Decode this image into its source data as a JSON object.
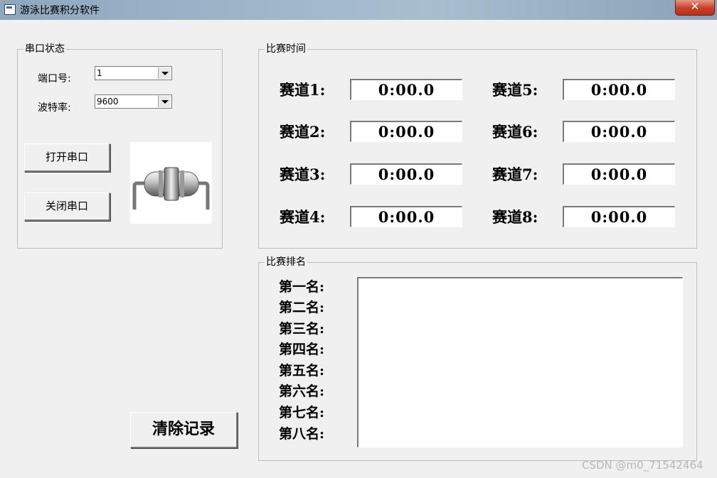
{
  "window": {
    "title": "游泳比赛积分软件",
    "close_label": "✕"
  },
  "serial": {
    "group_label": "串口状态",
    "port_label": "端口号:",
    "port_value": "1",
    "baud_label": "波特率:",
    "baud_value": "9600",
    "open_button": "打开串口",
    "close_button": "关闭串口"
  },
  "timing": {
    "group_label": "比赛时间",
    "lanes": [
      {
        "label": "赛道1:",
        "time": "0:00.0"
      },
      {
        "label": "赛道2:",
        "time": "0:00.0"
      },
      {
        "label": "赛道3:",
        "time": "0:00.0"
      },
      {
        "label": "赛道4:",
        "time": "0:00.0"
      },
      {
        "label": "赛道5:",
        "time": "0:00.0"
      },
      {
        "label": "赛道6:",
        "time": "0:00.0"
      },
      {
        "label": "赛道7:",
        "time": "0:00.0"
      },
      {
        "label": "赛道8:",
        "time": "0:00.0"
      }
    ]
  },
  "ranking": {
    "group_label": "比赛排名",
    "places": [
      "第一名:",
      "第二名:",
      "第三名:",
      "第四名:",
      "第五名:",
      "第六名:",
      "第七名:",
      "第八名:"
    ]
  },
  "actions": {
    "clear_button": "清除记录"
  },
  "watermark": "CSDN @m0_71542464",
  "icons": {
    "app": "app-window-icon",
    "serial_picture": "serial-connector-icon",
    "dropdown": "chevron-down-icon"
  }
}
